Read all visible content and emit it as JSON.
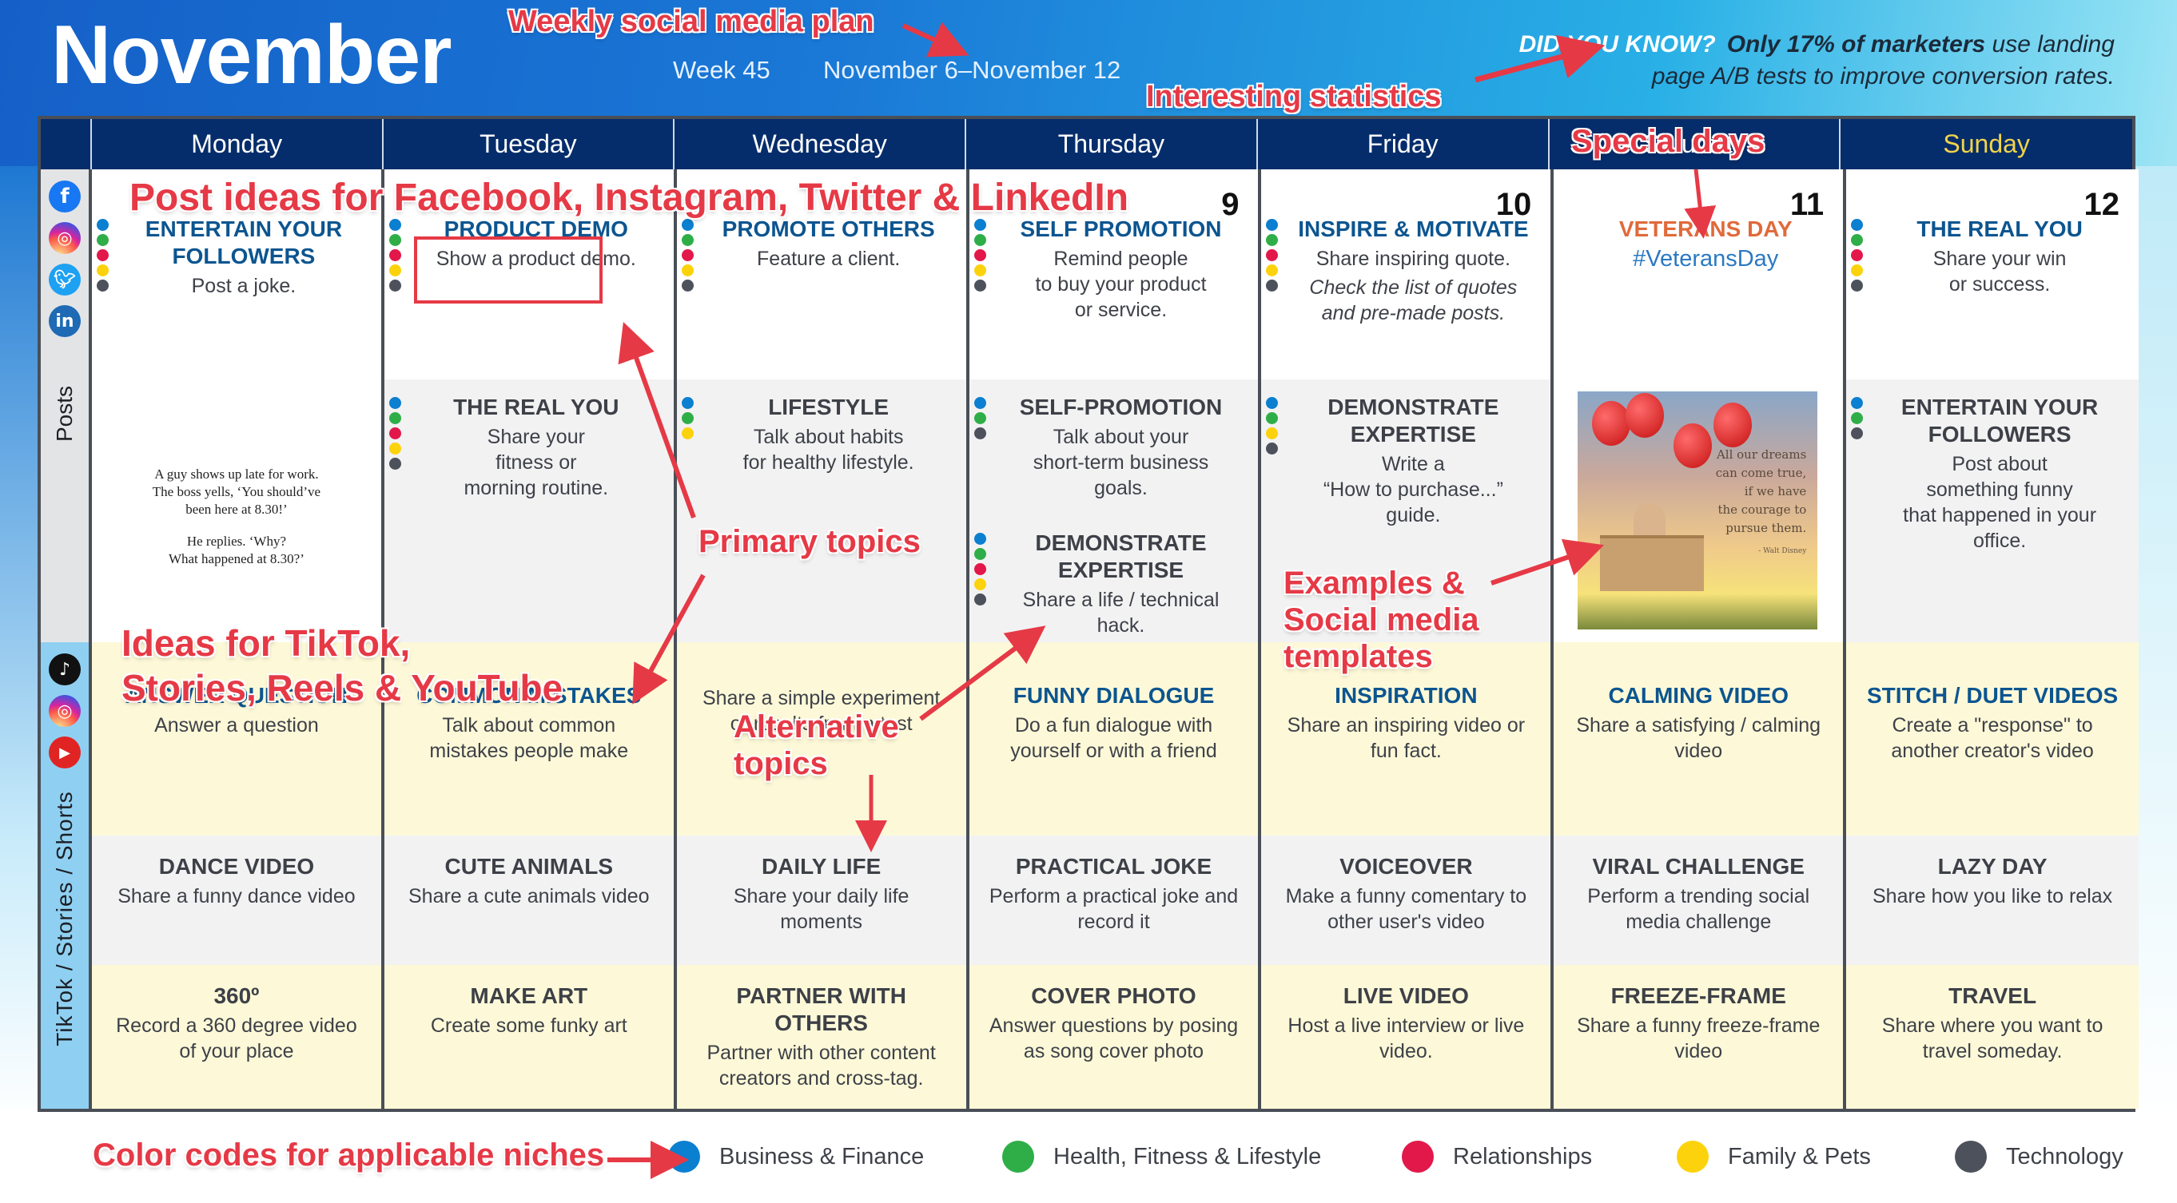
{
  "header": {
    "title": "November",
    "week": "Week 45",
    "date_range": "November 6–November 12",
    "did_you_know_label": "DID YOU KNOW?",
    "did_you_know_strong": "Only 17% of marketers",
    "did_you_know_rest": " use landing page A/B tests to improve conversion rates."
  },
  "days": [
    {
      "name": "Monday",
      "date": ""
    },
    {
      "name": "Tuesday",
      "date": ""
    },
    {
      "name": "Wednesday",
      "date": ""
    },
    {
      "name": "Thursday",
      "date": "9"
    },
    {
      "name": "Friday",
      "date": "10"
    },
    {
      "name": "Saturday",
      "date": "11"
    },
    {
      "name": "Sunday",
      "date": "12"
    }
  ],
  "sections": {
    "posts_label": "Posts",
    "tiktok_label": "TikTok / Stories / Shorts",
    "posts_icons": [
      "facebook-icon",
      "instagram-icon",
      "twitter-icon",
      "linkedin-icon"
    ],
    "tiktok_icons": [
      "tiktok-icon",
      "instagram-icon",
      "youtube-icon"
    ]
  },
  "niche_colors": {
    "business": "#0b7fd0",
    "health": "#2fae48",
    "relationships": "#e2184a",
    "family": "#fcd20c",
    "technology": "#4d515c"
  },
  "posts": {
    "primary": [
      {
        "title": "ENTERTAIN YOUR FOLLOWERS",
        "desc": "Post a joke.",
        "niches": [
          "business",
          "health",
          "relationships",
          "family",
          "technology"
        ]
      },
      {
        "title": "PRODUCT DEMO",
        "desc": "Show a product demo.",
        "niches": [
          "business",
          "health",
          "relationships",
          "family",
          "technology"
        ]
      },
      {
        "title": "PROMOTE OTHERS",
        "desc": "Feature a client.",
        "niches": [
          "business",
          "health",
          "relationships",
          "family",
          "technology"
        ]
      },
      {
        "title": "SELF PROMOTION",
        "desc": "Remind people\nto buy your product\nor service.",
        "niches": [
          "business",
          "health",
          "relationships",
          "family",
          "technology"
        ]
      },
      {
        "title": "INSPIRE & MOTIVATE",
        "desc": "Share inspiring quote.",
        "desc_italic": "Check the list of quotes\nand pre-made posts.",
        "niches": [
          "business",
          "health",
          "relationships",
          "family",
          "technology"
        ]
      },
      {
        "title": "VETERANS DAY",
        "hashtag": "#VeteransDay",
        "niches": []
      },
      {
        "title": "THE REAL YOU",
        "desc": "Share your win\nor success.",
        "niches": [
          "business",
          "health",
          "relationships",
          "family",
          "technology"
        ]
      }
    ],
    "secondary": [
      {
        "joke": [
          "A guy shows up late for work.\nThe boss yells, ‘You should’ve\nbeen here at 8.30!’",
          "He replies. ‘Why?\nWhat happened at 8.30?’"
        ]
      },
      {
        "title": "THE REAL YOU",
        "desc": "Share your\nfitness or\nmorning routine.",
        "niches": [
          "business",
          "health",
          "relationships",
          "family",
          "technology"
        ]
      },
      {
        "title": "LIFESTYLE",
        "desc": "Talk about habits\nfor healthy lifestyle.",
        "niches": [
          "business",
          "health",
          "family"
        ]
      },
      {
        "title": "SELF-PROMOTION",
        "desc": "Talk about your\nshort-term business\ngoals.",
        "niches": [
          "business",
          "health",
          "technology"
        ],
        "extra": {
          "title": "DEMONSTRATE EXPERTISE",
          "desc": "Share a life / technical\nhack.",
          "niches": [
            "business",
            "health",
            "relationships",
            "family",
            "technology"
          ]
        }
      },
      {
        "title": "DEMONSTRATE EXPERTISE",
        "desc": "Write a\n“How to purchase...”\nguide.",
        "niches": [
          "business",
          "health",
          "family",
          "technology"
        ]
      },
      {
        "image_quote": "All our dreams\ncan come true,\nif we have\nthe courage to\npursue them.",
        "image_author": "- Walt Disney"
      },
      {
        "title": "ENTERTAIN YOUR FOLLOWERS",
        "desc": "Post about\nsomething funny\nthat happened in your office.",
        "niches": [
          "business",
          "health",
          "technology"
        ]
      }
    ]
  },
  "tiktok": {
    "row1": [
      {
        "title": "ANSWER QUESTION",
        "desc": "Answer a question"
      },
      {
        "title": "COMMON MISTAKES",
        "desc": "Talk about common\nmistakes people make"
      },
      {
        "title": "",
        "desc": "Share a simple experiment\nor results from a test"
      },
      {
        "title": "FUNNY DIALOGUE",
        "desc": "Do a fun dialogue with\nyourself or with a friend"
      },
      {
        "title": "INSPIRATION",
        "desc": "Share an inspiring video or\nfun fact."
      },
      {
        "title": "CALMING VIDEO",
        "desc": "Share a satisfying / calming\nvideo"
      },
      {
        "title": "STITCH / DUET VIDEOS",
        "desc": "Create a \"response\" to\nanother creator's video"
      }
    ],
    "row2": [
      {
        "title": "DANCE VIDEO",
        "desc": "Share a funny dance video"
      },
      {
        "title": "CUTE ANIMALS",
        "desc": "Share a cute animals video"
      },
      {
        "title": "DAILY LIFE",
        "desc": "Share your daily life\nmoments"
      },
      {
        "title": "PRACTICAL JOKE",
        "desc": "Perform a practical joke and\nrecord it"
      },
      {
        "title": "VOICEOVER",
        "desc": "Make a funny comentary to\nother user's video"
      },
      {
        "title": "VIRAL CHALLENGE",
        "desc": "Perform a trending social\nmedia challenge"
      },
      {
        "title": "LAZY DAY",
        "desc": "Share how you like to relax"
      }
    ],
    "row3": [
      {
        "title": "360º",
        "desc": "Record a 360 degree video\nof your place"
      },
      {
        "title": "MAKE ART",
        "desc": "Create some funky art"
      },
      {
        "title": "PARTNER WITH OTHERS",
        "desc": "Partner with other content\ncreators and cross-tag."
      },
      {
        "title": "COVER PHOTO",
        "desc": "Answer questions by posing\nas song cover photo"
      },
      {
        "title": "LIVE VIDEO",
        "desc": "Host a live interview or live\nvideo."
      },
      {
        "title": "FREEZE-FRAME",
        "desc": "Share a funny freeze-frame\nvideo"
      },
      {
        "title": "TRAVEL",
        "desc": "Share where you want to\ntravel someday."
      }
    ]
  },
  "legend": [
    {
      "key": "business",
      "label": "Business & Finance"
    },
    {
      "key": "health",
      "label": "Health, Fitness & Lifestyle"
    },
    {
      "key": "relationships",
      "label": "Relationships"
    },
    {
      "key": "family",
      "label": "Family & Pets"
    },
    {
      "key": "technology",
      "label": "Technology"
    }
  ],
  "annotations": {
    "weekly_plan": "Weekly social media plan",
    "interesting_stats": "Interesting statistics",
    "special_days": "Special days",
    "post_ideas": "Post ideas for Facebook, Instagram, Twitter & LinkedIn",
    "primary_topics": "Primary topics",
    "tiktok_ideas_1": "Ideas for TikTok,",
    "tiktok_ideas_2": "Stories, Reels & YouTube",
    "alternative_1": "Alternative",
    "alternative_2": "topics",
    "examples_1": "Examples &",
    "examples_2": "Social media",
    "examples_3": "templates",
    "color_codes": "Color codes for applicable niches"
  }
}
